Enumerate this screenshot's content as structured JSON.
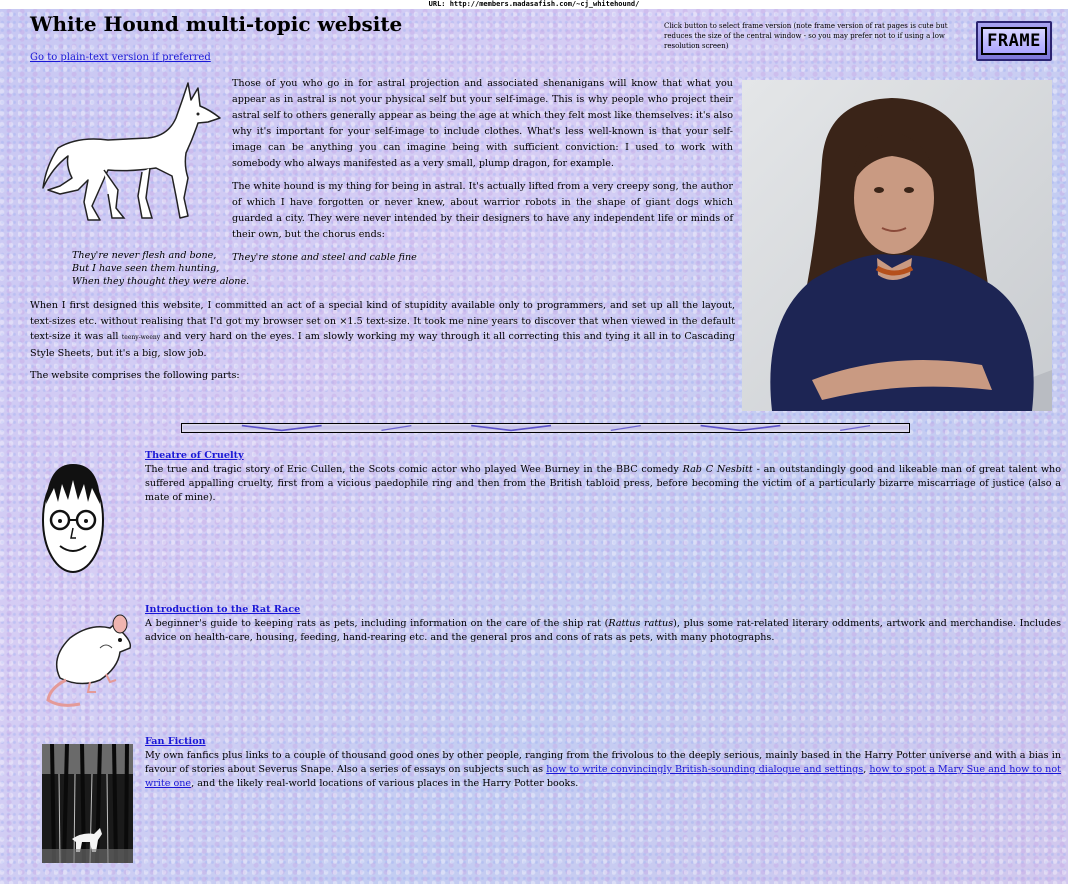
{
  "url": "URL: http://members.madasafish.com/~cj_whitehound/",
  "page": {
    "title": "White Hound multi-topic website",
    "plain_text_link": "Go to plain-text version if preferred",
    "frame_note": "Click button to select frame version (note frame version of rat pages is cute but reduces the size of the central window - so you may prefer not to if using a low resolution screen)",
    "frame_button": "FRAME"
  },
  "intro": {
    "p1": "Those of you who go in for astral projection and associated shenanigans will know that what you appear as in astral is not your physical self but your self-image. This is why people who project their astral self to others generally appear as being the age at which they felt most like themselves: it's also why it's important for your self-image to include clothes. What's less well-known is that your self-image can be anything you can imagine being with sufficient conviction: I used to work with somebody who always manifested as a very small, plump dragon, for example.",
    "p2": "The white hound is my thing for being in astral. It's actually lifted from a very creepy song, the author of which I have forgotten or never knew, about warrior robots in the shape of giant dogs which guarded a city. They were never intended by their designers to have any independent life or minds of their own, but the chorus ends:",
    "quote1": "They're stone and steel and cable fine",
    "verse": [
      "They're never flesh and bone,",
      "But I have seen them hunting,",
      "When they thought they were alone."
    ]
  },
  "body": {
    "p1_a": "When I first designed this website, I committed an act of a special kind of stupidity available only to programmers, and set up all the layout, text-sizes etc. without realising that I'd got my browser set on ×1.5 text-size. It took me nine years to discover that when viewed in the default text-size it was all",
    "p1_tiny": "teeny-weeny",
    "p1_b": "and very hard on the eyes. I am slowly working my way through it all correcting this and tying it all in to Cascading Style Sheets, but it's a big, slow job.",
    "p2": "The website comprises the following parts:"
  },
  "sections": [
    {
      "title": "Theatre of Cruelty",
      "text_a": "The true and tragic story of Eric Cullen, the Scots comic actor who played Wee Burney in the BBC comedy ",
      "text_em": "Rab C Nesbitt",
      "text_b": " - an outstandingly good and likeable man of great talent who suffered appalling cruelty, first from a vicious paedophile ring and then from the British tabloid press, before becoming the victim of a particularly bizarre miscarriage of justice (also a mate of mine)."
    },
    {
      "title": "Introduction to the Rat Race",
      "text_a": "A beginner's guide to keeping rats as pets, including information on the care of the ship rat (",
      "text_em": "Rattus rattus",
      "text_b": "), plus some rat-related literary oddments, artwork and merchandise. Includes advice on health-care, housing, feeding, hand-rearing etc. and the general pros and cons of rats as pets, with many photographs."
    },
    {
      "title": "Fan Fiction",
      "text_a": "My own fanfics plus links to a couple of thousand good ones by other people, ranging from the frivolous to the deeply serious, mainly based in the Harry Potter universe and with a bias in favour of stories about Severus Snape. Also a series of essays on subjects such as ",
      "link1": "how to write convincingly British-sounding dialogue and settings",
      "sep": ", ",
      "link2": "how to spot a Mary Sue and how to not write one",
      "text_b": ", and the likely real-world locations of various places in the Harry Potter books."
    }
  ],
  "colors": {
    "link": "#1a17d6",
    "background": "#c7c8f3",
    "frame_button": "#8f89e6"
  }
}
